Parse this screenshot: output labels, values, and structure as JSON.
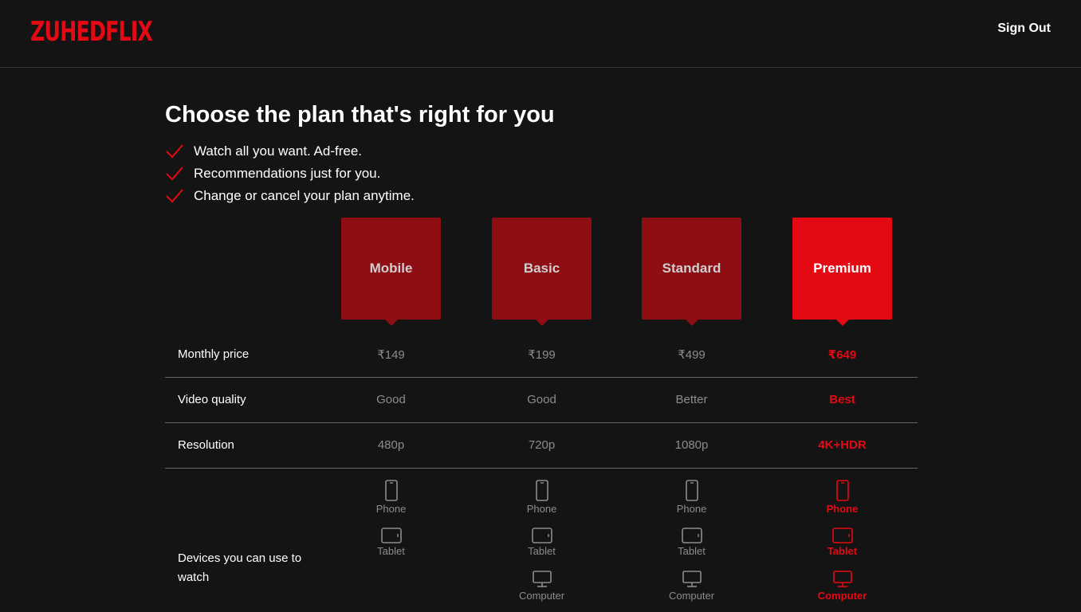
{
  "header": {
    "logo": "ZUHEDFLIX",
    "sign_out": "Sign Out"
  },
  "title": "Choose the plan that's right for you",
  "benefits": [
    "Watch all you want. Ad-free.",
    "Recommendations just for you.",
    "Change or cancel your plan anytime."
  ],
  "plans": [
    "Mobile",
    "Basic",
    "Standard",
    "Premium"
  ],
  "selected_plan": "Premium",
  "rows": {
    "price": {
      "label": "Monthly price",
      "values": [
        "₹149",
        "₹199",
        "₹499",
        "₹649"
      ]
    },
    "quality": {
      "label": "Video quality",
      "values": [
        "Good",
        "Good",
        "Better",
        "Best"
      ]
    },
    "resolution": {
      "label": "Resolution",
      "values": [
        "480p",
        "720p",
        "1080p",
        "4K+HDR"
      ]
    }
  },
  "devices": {
    "label": "Devices you can use to watch",
    "phone": "Phone",
    "tablet": "Tablet",
    "computer": "Computer"
  },
  "colors": {
    "brand": "#e50914",
    "card": "#8e0e14",
    "background": "#141414",
    "muted": "#8c8c8c"
  }
}
